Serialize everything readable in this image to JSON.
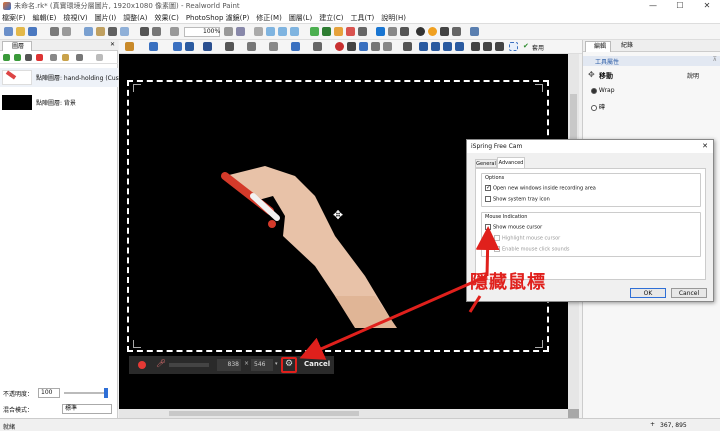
{
  "titlebar": {
    "title": "未命名.rk* (真實環境分層圖片, 1920x1080 像素圖) - Realworld Paint",
    "minimize": "—",
    "maximize": "☐",
    "close": "✕"
  },
  "menu": [
    "檔案(F)",
    "編輯(E)",
    "檢視(V)",
    "圖片(I)",
    "調整(A)",
    "效果(C)",
    "PhotoShop 濾鏡(P)",
    "修正(M)",
    "圖層(L)",
    "建立(C)",
    "工具(T)",
    "說明(H)"
  ],
  "toolbar": {
    "zoom_value": "100%",
    "apply_label": "套用"
  },
  "layers_panel": {
    "tab_label": "圖層",
    "close": "✕",
    "layers": [
      {
        "label": "點陣圖層: hand-holding (Cust"
      },
      {
        "label": "點陣圖層: 背景"
      }
    ],
    "opacity_label": "不透明度：",
    "opacity_value": "100",
    "blend_label": "混合模式：",
    "blend_value": "標準"
  },
  "right_panel": {
    "tab_edit": "編輯",
    "tab_history": "紀錄",
    "tool_props_label": "工具屬性",
    "tool_name": "移動",
    "help_label": "說明",
    "option_wrap": "Wrap",
    "option_tile": "磚"
  },
  "dialog": {
    "title": "iSpring Free Cam",
    "close": "✕",
    "tab_general": "General",
    "tab_advanced": "Advanced",
    "options_group": "Options",
    "opt_open_windows": "Open new windows inside recording area",
    "opt_tray_icon": "Show system tray icon",
    "mouse_group": "Mouse Indication",
    "mouse_show": "Show mouse cursor",
    "mouse_highlight": "Highlight mouse cursor",
    "mouse_clicks": "Enable mouse click sounds",
    "ok": "OK",
    "cancel": "Cancel"
  },
  "annotation": {
    "text": "隱藏鼠標",
    "color": "#e0201c"
  },
  "recording_bar": {
    "width": "838",
    "x": "×",
    "height": "546",
    "cancel": "Cancel"
  },
  "statusbar": {
    "left": "就緒",
    "coords": "367, 895"
  },
  "colors": {
    "canvas_bg": "#000000",
    "accent": "#2f6fd6",
    "arrow": "#e0201c"
  }
}
